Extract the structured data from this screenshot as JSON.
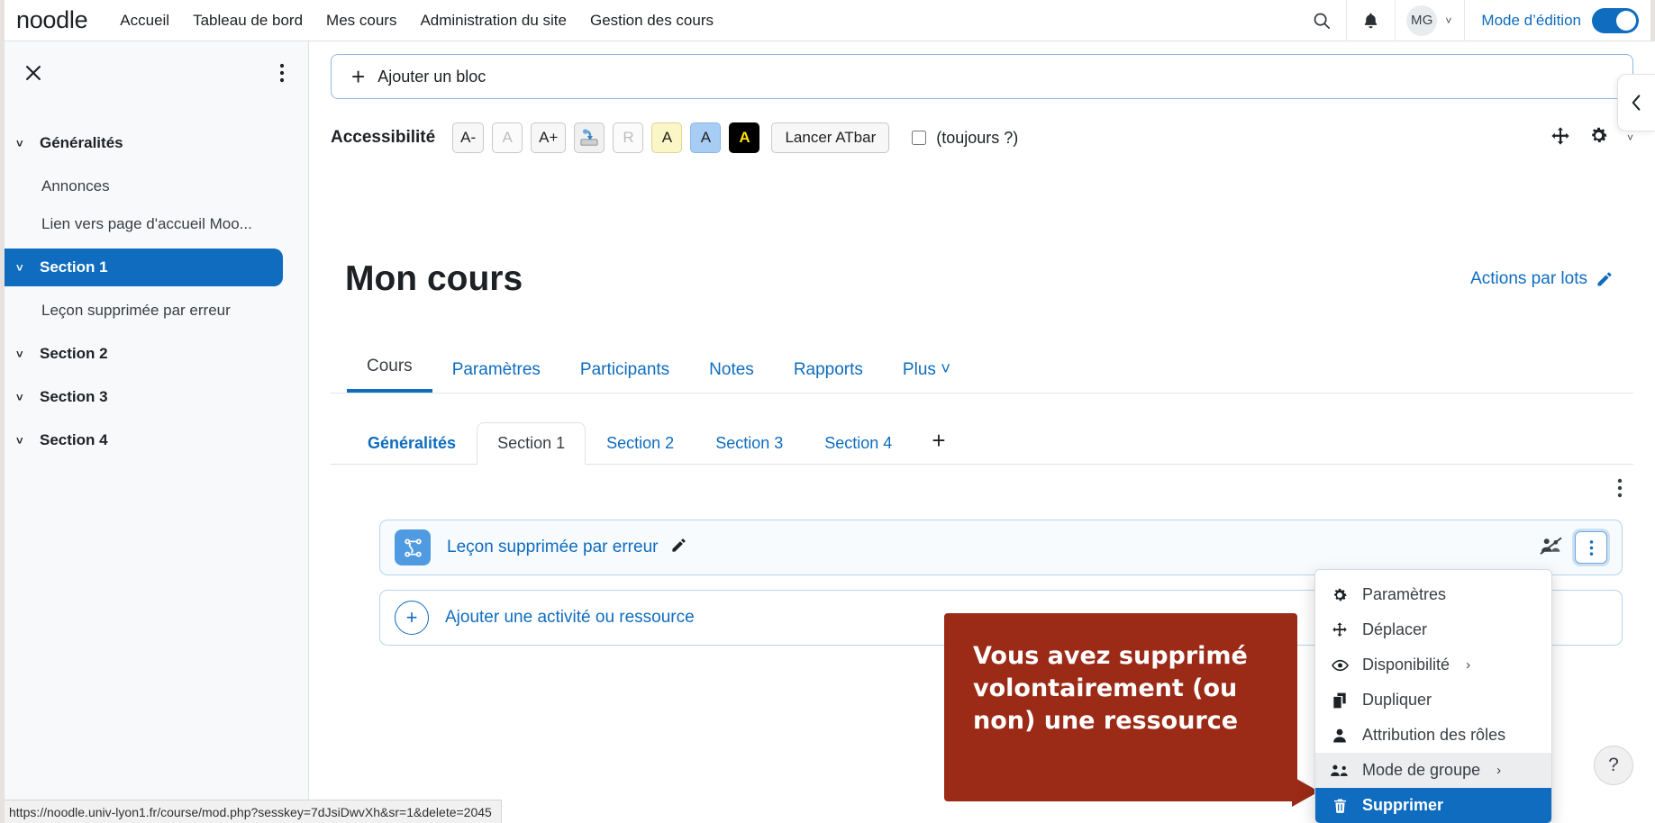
{
  "navbar": {
    "brand": "noodle",
    "links": [
      {
        "label": "Accueil"
      },
      {
        "label": "Tableau de bord"
      },
      {
        "label": "Mes cours"
      },
      {
        "label": "Administration du site"
      },
      {
        "label": "Gestion des cours"
      }
    ],
    "search_icon": "search-icon",
    "notifications_icon": "bell-icon",
    "user_initials": "MG",
    "user_caret": "˅",
    "edit_mode_label": "Mode d’édition",
    "edit_mode_on": true,
    "accent_color": "#0f6cbf"
  },
  "sidebar": {
    "close_label": "✕",
    "kebab_label": "⋮",
    "items": [
      {
        "label": "Généralités",
        "type": "section",
        "active": false,
        "chevron": "˅"
      },
      {
        "label": "Annonces",
        "type": "activity"
      },
      {
        "label": "Lien vers page d'accueil Moo...",
        "type": "activity"
      },
      {
        "label": "Section 1",
        "type": "section",
        "active": true,
        "chevron": "˅"
      },
      {
        "label": "Leçon supprimée par erreur",
        "type": "activity"
      },
      {
        "label": "Section 2",
        "type": "section",
        "active": false,
        "chevron": "˅"
      },
      {
        "label": "Section 3",
        "type": "section",
        "active": false,
        "chevron": "˅"
      },
      {
        "label": "Section 4",
        "type": "section",
        "active": false,
        "chevron": "˅"
      }
    ]
  },
  "add_block": {
    "plus": "+",
    "label": "Ajouter un bloc"
  },
  "accessibility": {
    "title": "Accessibilité",
    "buttons": [
      {
        "label": "A-",
        "style": "normal",
        "name": "decrease-font-size-button"
      },
      {
        "label": "A",
        "style": "dim",
        "name": "reset-font-size-button"
      },
      {
        "label": "A+",
        "style": "normal",
        "name": "increase-font-size-button"
      },
      {
        "label": "",
        "style": "icon",
        "name": "dictionary-icon"
      },
      {
        "label": "R",
        "style": "dim",
        "name": "reset-button"
      },
      {
        "label": "A",
        "style": "yellow",
        "name": "contrast-yellow-button"
      },
      {
        "label": "A",
        "style": "blue",
        "name": "contrast-blue-button"
      },
      {
        "label": "A",
        "style": "black",
        "name": "contrast-black-button"
      }
    ],
    "launch_label": "Lancer ATbar",
    "always_label": "(toujours ?)",
    "always_checked": false
  },
  "course": {
    "title": "Mon cours",
    "bulk_actions_label": "Actions par lots",
    "bulk_actions_icon": "pencil-icon",
    "tabs": [
      {
        "label": "Cours",
        "active": true
      },
      {
        "label": "Paramètres",
        "active": false
      },
      {
        "label": "Participants",
        "active": false
      },
      {
        "label": "Notes",
        "active": false
      },
      {
        "label": "Rapports",
        "active": false
      },
      {
        "label": "Plus ˅",
        "active": false
      }
    ],
    "section_tabs": [
      {
        "label": "Généralités",
        "state": "bold"
      },
      {
        "label": "Section 1",
        "state": "current"
      },
      {
        "label": "Section 2",
        "state": "normal"
      },
      {
        "label": "Section 3",
        "state": "normal"
      },
      {
        "label": "Section 4",
        "state": "normal"
      },
      {
        "label": "+",
        "state": "add"
      }
    ],
    "section_kebab": "⋮"
  },
  "activity": {
    "name": "Leçon supprimée par erreur",
    "icon": "lesson-icon",
    "edit_icon": "pencil-icon",
    "groups_icon": "no-groups-icon",
    "kebab": "⋮"
  },
  "add_activity": {
    "plus": "+",
    "label": "Ajouter une activité ou ressource"
  },
  "dropdown": {
    "items": [
      {
        "label": "Paramètres",
        "icon": "gear-icon",
        "state": "normal",
        "arrow": ""
      },
      {
        "label": "Déplacer",
        "icon": "move-icon",
        "state": "normal",
        "arrow": ""
      },
      {
        "label": "Disponibilité",
        "icon": "eye-icon",
        "state": "normal",
        "arrow": "›"
      },
      {
        "label": "Dupliquer",
        "icon": "duplicate-icon",
        "state": "normal",
        "arrow": ""
      },
      {
        "label": "Attribution des rôles",
        "icon": "user-icon",
        "state": "normal",
        "arrow": ""
      },
      {
        "label": "Mode de groupe",
        "icon": "groups-icon",
        "state": "hover",
        "arrow": "›"
      },
      {
        "label": "Supprimer",
        "icon": "trash-icon",
        "state": "selected",
        "arrow": ""
      }
    ]
  },
  "callout": {
    "text": "Vous avez supprimé volontairement (ou non) une ressource",
    "background_color": "#9b2a17",
    "text_color": "#ffffff"
  },
  "help": {
    "label": "?"
  },
  "status_bar": {
    "url": "https://noodle.univ-lyon1.fr/course/mod.php?sesskey=7dJsiDwvXh&sr=1&delete=2045"
  },
  "right_drawer": {
    "toggle_icon": "chevron-left-icon"
  }
}
